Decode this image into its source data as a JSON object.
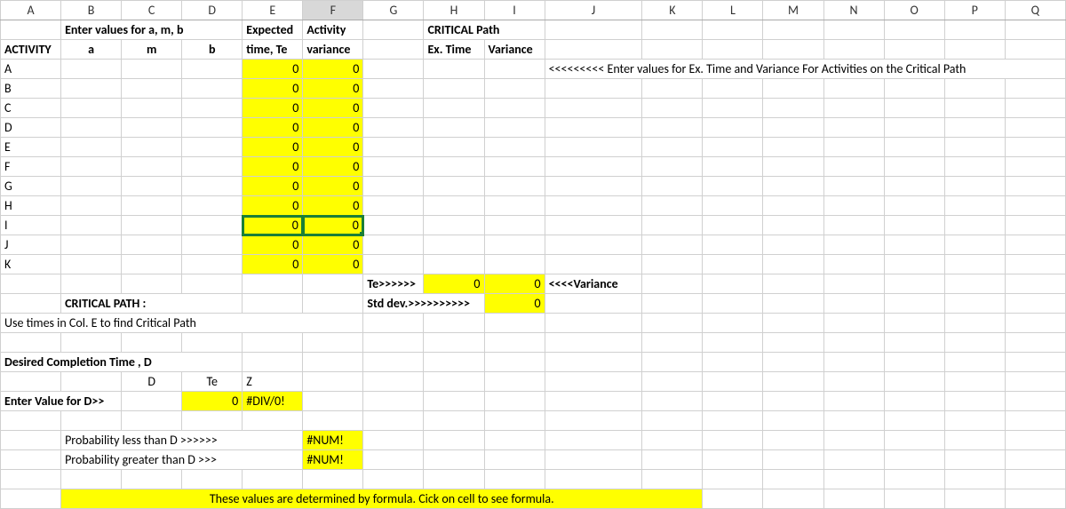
{
  "columns": [
    "A",
    "B",
    "C",
    "D",
    "E",
    "F",
    "G",
    "H",
    "I",
    "J",
    "K",
    "L",
    "M",
    "N",
    "O",
    "P",
    "Q"
  ],
  "activeColumn": "F",
  "header": {
    "enterValues": "Enter values for a, m, b",
    "expected": "Expected",
    "activity": "Activity",
    "criticalPath": "CRITICAL Path"
  },
  "subheader": {
    "activity": "ACTIVITY",
    "a": "a",
    "m": "m",
    "b": "b",
    "timeTe": "time, Te",
    "variance": "variance",
    "exTime": "Ex. Time",
    "exVar": "Variance"
  },
  "activities": [
    {
      "name": "A",
      "te": "0",
      "var": "0"
    },
    {
      "name": "B",
      "te": "0",
      "var": "0"
    },
    {
      "name": "C",
      "te": "0",
      "var": "0"
    },
    {
      "name": "D",
      "te": "0",
      "var": "0"
    },
    {
      "name": "E",
      "te": "0",
      "var": "0"
    },
    {
      "name": "F",
      "te": "0",
      "var": "0"
    },
    {
      "name": "G",
      "te": "0",
      "var": "0"
    },
    {
      "name": "H",
      "te": "0",
      "var": "0"
    },
    {
      "name": "I",
      "te": "0",
      "var": "0"
    },
    {
      "name": "J",
      "te": "0",
      "var": "0"
    },
    {
      "name": "K",
      "te": "0",
      "var": "0"
    }
  ],
  "enterCriticalNote": "<<<<<<<<< Enter values for Ex. Time and Variance For Activities on the Critical Path",
  "summary": {
    "teLabel": "Te>>>>>>",
    "teVal": "0",
    "varVal": "0",
    "varLabel": "<<<<Variance",
    "stdLabel": "Std dev.>>>>>>>>>>",
    "stdVal": "0"
  },
  "critical": {
    "title": "CRITICAL PATH :",
    "note": "Use times in Col. E to find Critical Path"
  },
  "desired": {
    "title": "Desired Completion Time , D",
    "D": "D",
    "Te": "Te",
    "Z": "Z",
    "enterD": "Enter Value for D>>",
    "zVal": "0",
    "divErr": "#DIV/0!"
  },
  "prob": {
    "lessLabel": "Probability less than D >>>>>>",
    "lessVal": "#NUM!",
    "greaterLabel": "Probability greater than D >>>",
    "greaterVal": "#NUM!"
  },
  "footerNote": "These values are determined by formula. Cick on cell to see formula."
}
